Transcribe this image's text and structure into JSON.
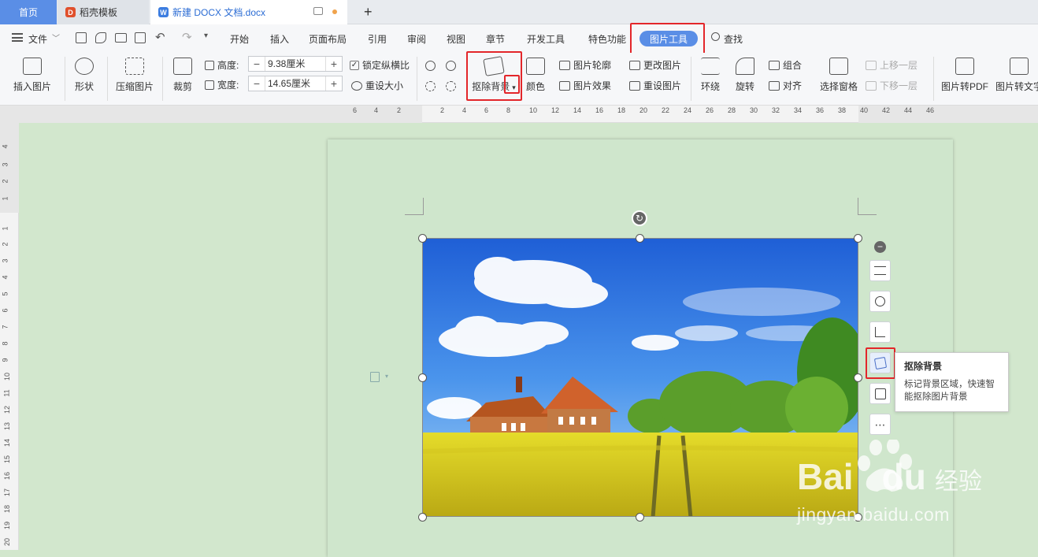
{
  "tabs": {
    "home": "首页",
    "template": "稻壳模板",
    "doc": "新建 DOCX 文档.docx",
    "new_tab": "+"
  },
  "menu": {
    "file": "文件",
    "tabs": [
      "开始",
      "插入",
      "页面布局",
      "引用",
      "审阅",
      "视图",
      "章节",
      "开发工具",
      "特色功能"
    ],
    "picture_tools": "图片工具",
    "find": "查找"
  },
  "ribbon": {
    "insert_picture": "插入图片",
    "shape": "形状",
    "compress": "压缩图片",
    "crop": "裁剪",
    "height_label": "高度:",
    "height_value": "9.38厘米",
    "width_label": "宽度:",
    "width_value": "14.65厘米",
    "lock_ratio": "锁定纵横比",
    "reset_size": "重设大小",
    "remove_bg": "抠除背景",
    "color": "颜色",
    "outline": "图片轮廓",
    "effect": "图片效果",
    "change_picture": "更改图片",
    "reset_picture": "重设图片",
    "wrap": "环绕",
    "rotate": "旋转",
    "group": "组合",
    "align": "对齐",
    "selection_pane": "选择窗格",
    "bring_forward": "上移一层",
    "send_backward": "下移一层",
    "to_pdf": "图片转PDF",
    "to_text": "图片转文字"
  },
  "hruler_ticks": [
    "6",
    "4",
    "2",
    "2",
    "4",
    "6",
    "8",
    "10",
    "12",
    "14",
    "16",
    "18",
    "20",
    "22",
    "24",
    "26",
    "28",
    "30",
    "32",
    "34",
    "36",
    "38",
    "40",
    "42",
    "44",
    "46"
  ],
  "vruler_ticks": [
    "4",
    "3",
    "2",
    "1",
    "1",
    "2",
    "3",
    "4",
    "5",
    "6",
    "7",
    "8",
    "9",
    "10",
    "11",
    "12",
    "13",
    "14",
    "15",
    "16",
    "17",
    "18",
    "19",
    "20"
  ],
  "tooltip": {
    "title": "抠除背景",
    "body": "标记背景区域，快速智能抠除图片背景"
  },
  "watermark": {
    "brand": "Bai",
    "brand2": "du",
    "jingyan": "经验",
    "url": "jingyan.baidu.com"
  },
  "colors": {
    "accent": "#5a8ee6",
    "highlight": "#e3262a",
    "canvas": "#d2e7cd"
  }
}
